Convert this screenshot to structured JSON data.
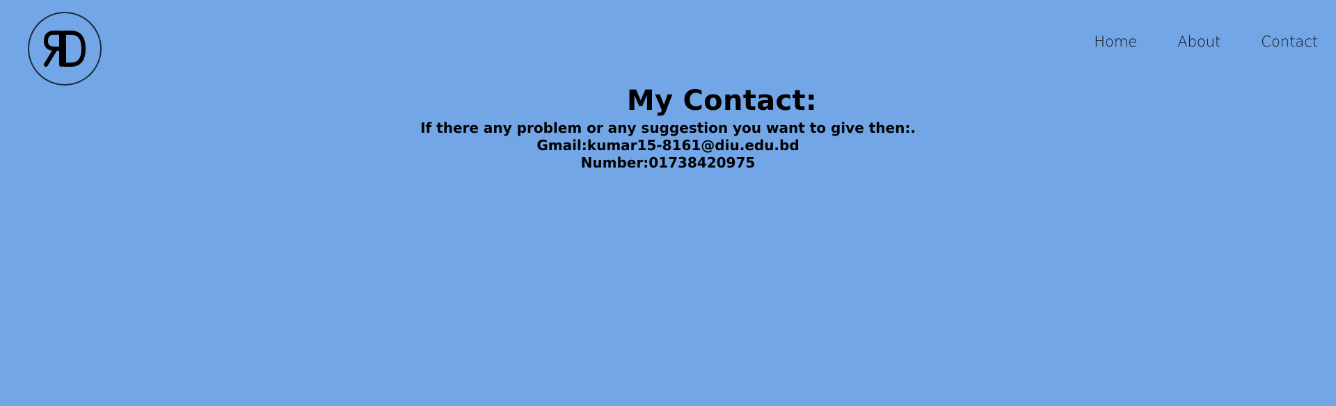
{
  "logo": {
    "text": "RD"
  },
  "nav": {
    "home": "Home",
    "about": "About",
    "contact": "Contact"
  },
  "main": {
    "title": "My Contact:",
    "intro": "If there any problem or any suggestion you want to give then:.",
    "gmail": "Gmail:kumar15-8161@diu.edu.bd",
    "number": "Number:01738420975"
  },
  "colors": {
    "background": "#72a6e6",
    "text": "#000000"
  }
}
